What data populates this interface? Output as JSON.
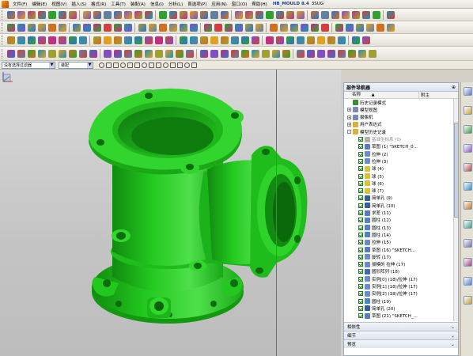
{
  "menubar": {
    "items": [
      "文件(F)",
      "编辑(E)",
      "视图(V)",
      "插入(S)",
      "格式(R)",
      "工具(T)",
      "装配(A)",
      "信息(I)",
      "分析(L)",
      "首选项(P)",
      "应用(N)",
      "窗口(O)",
      "帮助(H)"
    ],
    "title": "HB_MOULD 8.4",
    "extra": "3SUG"
  },
  "selection_bar": {
    "filter": "没有选择过滤器",
    "scope": "装配"
  },
  "navigator": {
    "title": "部件导航器",
    "pin": "⊕",
    "col_name": "名称",
    "col_sort": "▲",
    "col_new": "附主",
    "items": [
      {
        "label": "历史记录模式",
        "icon": "#3a8a3a",
        "level": 0,
        "exp": "",
        "chk": false
      },
      {
        "label": "模型视图",
        "icon": "#7a8ab8",
        "level": 0,
        "exp": "+",
        "chk": false
      },
      {
        "label": "摄像机",
        "icon": "#7a8ab8",
        "level": 0,
        "exp": "+",
        "chk": false
      },
      {
        "label": "用户表达式",
        "icon": "#d8b040",
        "level": 0,
        "exp": "+",
        "chk": false
      },
      {
        "label": "模型历史记录",
        "icon": "#d8b040",
        "level": 0,
        "exp": "-",
        "chk": false
      },
      {
        "label": "基准坐标系 (0)",
        "icon": "#b0b0b0",
        "level": 1,
        "exp": "",
        "chk": true,
        "dim": true
      },
      {
        "label": "草图 (1) \"SKETCH_0...",
        "icon": "#5a7ac8",
        "level": 1,
        "exp": "",
        "chk": true
      },
      {
        "label": "拉伸 (2)",
        "icon": "#6a8ad8",
        "level": 1,
        "exp": "",
        "chk": true
      },
      {
        "label": "拉伸 (3)",
        "icon": "#6a8ad8",
        "level": 1,
        "exp": "",
        "chk": true
      },
      {
        "label": "球 (4)",
        "icon": "#e0c030",
        "level": 1,
        "exp": "",
        "chk": true
      },
      {
        "label": "球 (5)",
        "icon": "#e0c030",
        "level": 1,
        "exp": "",
        "chk": true
      },
      {
        "label": "球 (6)",
        "icon": "#e0c030",
        "level": 1,
        "exp": "",
        "chk": true
      },
      {
        "label": "球 (7)",
        "icon": "#e0c030",
        "level": 1,
        "exp": "",
        "chk": true
      },
      {
        "label": "简单孔 (9)",
        "icon": "#3060a0",
        "level": 1,
        "exp": "",
        "chk": true
      },
      {
        "label": "简单孔 (10)",
        "icon": "#3060a0",
        "level": 1,
        "exp": "",
        "chk": true
      },
      {
        "label": "求差 (11)",
        "icon": "#5a7ac8",
        "level": 1,
        "exp": "",
        "chk": true
      },
      {
        "label": "圆柱 (12)",
        "icon": "#5080d0",
        "level": 1,
        "exp": "",
        "chk": true
      },
      {
        "label": "圆柱 (13)",
        "icon": "#5080d0",
        "level": 1,
        "exp": "",
        "chk": true
      },
      {
        "label": "圆柱 (14)",
        "icon": "#5080d0",
        "level": 1,
        "exp": "",
        "chk": true
      },
      {
        "label": "拉伸 (15)",
        "icon": "#6a8ad8",
        "level": 1,
        "exp": "",
        "chk": true
      },
      {
        "label": "草图 (16) \"SKETCH...",
        "icon": "#5a7ac8",
        "level": 1,
        "exp": "",
        "chk": true
      },
      {
        "label": "旋转 (17)",
        "icon": "#6a8ad8",
        "level": 1,
        "exp": "",
        "chk": true
      },
      {
        "label": "拔模的 拉伸 (17)",
        "icon": "#6a8ad8",
        "level": 1,
        "exp": "",
        "chk": true
      },
      {
        "label": "圆形阵列 (18)",
        "icon": "#4068b8",
        "level": 1,
        "exp": "",
        "chk": true
      },
      {
        "label": "实例[0] (18)/拉伸 (17)",
        "icon": "#6a8ad8",
        "level": 1,
        "exp": "",
        "chk": true
      },
      {
        "label": "实例[1] (18)/拉伸 (17)",
        "icon": "#6a8ad8",
        "level": 1,
        "exp": "",
        "chk": true
      },
      {
        "label": "实例[2] (18)/拉伸 (17)",
        "icon": "#6a8ad8",
        "level": 1,
        "exp": "",
        "chk": true
      },
      {
        "label": "圆柱 (19)",
        "icon": "#5080d0",
        "level": 1,
        "exp": "",
        "chk": true
      },
      {
        "label": "简单孔 (20)",
        "icon": "#3060a0",
        "level": 1,
        "exp": "",
        "chk": true
      },
      {
        "label": "草图 (21) \"SKETCH_...",
        "icon": "#5a7ac8",
        "level": 1,
        "exp": "",
        "chk": true
      }
    ],
    "sections": [
      "相依性",
      "细节",
      "预览"
    ]
  },
  "colors": {
    "part": "#22c81e",
    "part_dark": "#118a10",
    "part_light": "#5ce858"
  }
}
